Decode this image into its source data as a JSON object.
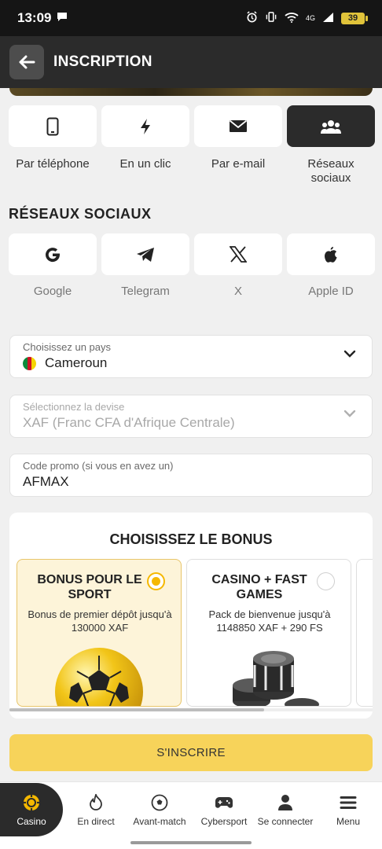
{
  "status_bar": {
    "time": "13:09",
    "network": "4G",
    "battery": "39"
  },
  "header": {
    "title": "INSCRIPTION"
  },
  "tabs": [
    {
      "label": "Par téléphone",
      "icon": "phone-icon"
    },
    {
      "label": "En un clic",
      "icon": "bolt-icon"
    },
    {
      "label": "Par e-mail",
      "icon": "envelope-icon"
    },
    {
      "label": "Réseaux sociaux",
      "icon": "users-icon",
      "active": true
    }
  ],
  "social_section": {
    "title": "RÉSEAUX SOCIAUX",
    "items": [
      {
        "label": "Google",
        "icon": "google-icon"
      },
      {
        "label": "Telegram",
        "icon": "telegram-icon"
      },
      {
        "label": "X",
        "icon": "x-icon"
      },
      {
        "label": "Apple ID",
        "icon": "apple-icon"
      }
    ]
  },
  "form": {
    "country": {
      "label": "Choisissez un pays",
      "value": "Cameroun"
    },
    "currency": {
      "label": "Sélectionnez la devise",
      "value": "XAF (Franc CFA d'Afrique Centrale)"
    },
    "promo": {
      "label": "Code promo (si vous en avez un)",
      "value": "AFMAX"
    }
  },
  "bonus": {
    "title": "CHOISISSEZ LE BONUS",
    "options": [
      {
        "title": "BONUS POUR LE SPORT",
        "description": "Bonus de premier dépôt jusqu'à 130000 XAF",
        "selected": true
      },
      {
        "title": "CASINO + FAST GAMES",
        "description": "Pack de bienvenue jusqu'à 1148850 XAF + 290 FS",
        "selected": false
      }
    ]
  },
  "submit_label": "S'INSCRIRE",
  "bottom_nav": [
    {
      "label": "Casino",
      "icon": "casino-chip-icon",
      "active": true
    },
    {
      "label": "En direct",
      "icon": "flame-icon"
    },
    {
      "label": "Avant-match",
      "icon": "soccer-ball-icon"
    },
    {
      "label": "Cybersport",
      "icon": "gamepad-icon"
    },
    {
      "label": "Se connecter",
      "icon": "user-icon"
    },
    {
      "label": "Menu",
      "icon": "hamburger-icon"
    }
  ],
  "colors": {
    "accent": "#f7d35a",
    "dark": "#2b2b2b",
    "selected_bonus_bg": "#fdf4d9"
  }
}
